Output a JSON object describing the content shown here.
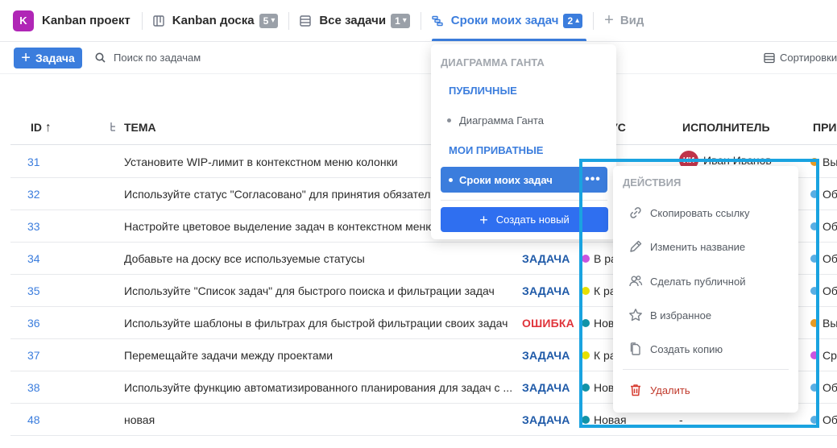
{
  "project": {
    "logo_letter": "K",
    "name": "Kanban проект",
    "logo_color": "#b026b6"
  },
  "tabs": [
    {
      "label": "Kanban доска",
      "count": "5",
      "icon": "board-icon",
      "active": false
    },
    {
      "label": "Все задачи",
      "count": "1",
      "icon": "list-icon",
      "active": false
    },
    {
      "label": "Сроки моих задач",
      "count": "2",
      "icon": "gantt-icon",
      "active": true
    }
  ],
  "add_view_label": "Вид",
  "toolbar": {
    "task_button": "Задача",
    "search_placeholder": "Поиск по задачам",
    "sort_label": "Сортировки"
  },
  "columns": {
    "id": "ID",
    "topic": "ТЕМА",
    "status": "УС",
    "assignee": "ИСПОЛНИТЕЛЬ",
    "priority": "ПРИ"
  },
  "rows": [
    {
      "id": "31",
      "topic": "Установите WIP-лимит в контекстном меню колонки",
      "type": "",
      "status": "",
      "status_color": "",
      "assignee": "Иван Иванов",
      "avatar": "ИИ",
      "priority": "Вы",
      "priority_color": "#e89b25"
    },
    {
      "id": "32",
      "topic": "Используйте статус \"Согласовано\" для принятия обязател",
      "type": "",
      "status": "",
      "status_color": "",
      "assignee": "",
      "avatar": "",
      "priority": "Об",
      "priority_color": "#5aaee3"
    },
    {
      "id": "33",
      "topic": "Настройте цветовое выделение задач в контекстном меню",
      "type": "",
      "status": "",
      "status_color": "",
      "assignee": "",
      "avatar": "",
      "priority": "Об",
      "priority_color": "#5aaee3"
    },
    {
      "id": "34",
      "topic": "Добавьте на доску все используемые статусы",
      "type": "ЗАДАЧА",
      "type_color": "#1f5aa8",
      "status": "В ра",
      "status_color": "#c955e0",
      "assignee": "",
      "avatar": "",
      "priority": "Об",
      "priority_color": "#5aaee3"
    },
    {
      "id": "35",
      "topic": "Используйте \"Список задач\" для быстрого поиска и фильтрации задач",
      "type": "ЗАДАЧА",
      "type_color": "#1f5aa8",
      "status": "К ра",
      "status_color": "#e8e000",
      "assignee": "",
      "avatar": "",
      "priority": "Об",
      "priority_color": "#5aaee3"
    },
    {
      "id": "36",
      "topic": "Используйте шаблоны в фильтрах для быстрой фильтрации своих задач",
      "type": "ОШИБКА",
      "type_color": "#e0343b",
      "status": "Нов",
      "status_color": "#1193a8",
      "assignee": "",
      "avatar": "",
      "priority": "Вы",
      "priority_color": "#e89b25"
    },
    {
      "id": "37",
      "topic": "Перемещайте задачи между проектами",
      "type": "ЗАДАЧА",
      "type_color": "#1f5aa8",
      "status": "К ра",
      "status_color": "#e8e000",
      "assignee": "",
      "avatar": "",
      "priority": "Ср",
      "priority_color": "#c955e0"
    },
    {
      "id": "38",
      "topic": "Используйте функцию автоматизированного планирования для задач с ...",
      "type": "ЗАДАЧА",
      "type_color": "#1f5aa8",
      "status": "Нов",
      "status_color": "#1193a8",
      "assignee": "",
      "avatar": "",
      "priority": "Об",
      "priority_color": "#5aaee3"
    },
    {
      "id": "48",
      "topic": "новая",
      "type": "ЗАДАЧА",
      "type_color": "#1f5aa8",
      "status": "Новая",
      "status_color": "#1193a8",
      "assignee": "-",
      "avatar": "",
      "priority": "Об",
      "priority_color": "#5aaee3"
    }
  ],
  "views_dropdown": {
    "header": "ДИАГРАММА ГАНТА",
    "public_section": "ПУБЛИЧНЫЕ",
    "public_item": "Диаграмма Ганта",
    "private_section": "МОИ ПРИВАТНЫЕ",
    "active_item": "Сроки моих задач",
    "more_label": "•••",
    "create_button": "Создать новый"
  },
  "actions_menu": {
    "header": "ДЕЙСТВИЯ",
    "items": [
      {
        "label": "Скопировать ссылку",
        "icon": "link-icon"
      },
      {
        "label": "Изменить название",
        "icon": "pencil-icon"
      },
      {
        "label": "Сделать публичной",
        "icon": "users-icon"
      },
      {
        "label": "В избранное",
        "icon": "star-icon"
      },
      {
        "label": "Создать копию",
        "icon": "copy-icon"
      }
    ],
    "delete_label": "Удалить"
  },
  "colors": {
    "accent": "#3b7ddd",
    "highlight": "#1aa3e0",
    "danger": "#d63a2f"
  }
}
